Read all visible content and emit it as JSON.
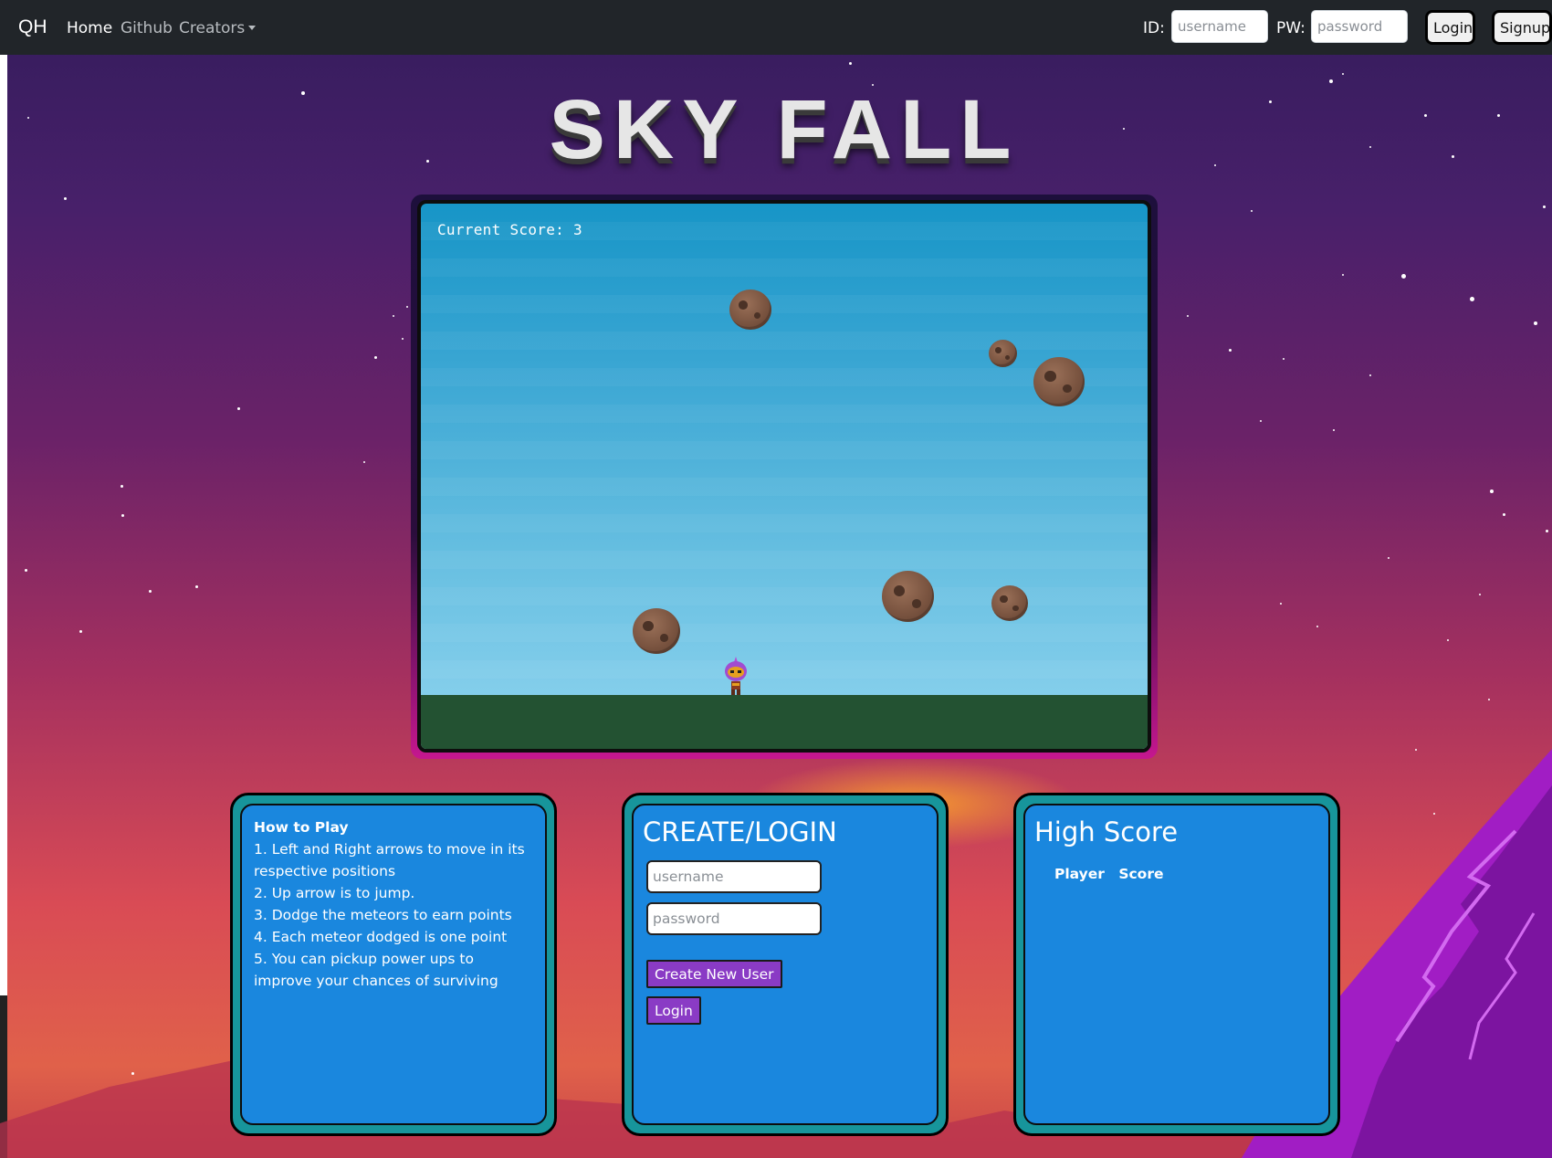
{
  "navbar": {
    "brand": "QH",
    "links": [
      {
        "label": "Home"
      },
      {
        "label": "Github"
      },
      {
        "label": "Creators"
      }
    ],
    "id_label": "ID:",
    "id_placeholder": "username",
    "pw_label": "PW:",
    "pw_placeholder": "password",
    "login_label": "Login",
    "signup_label": "Signup"
  },
  "title": "SKY FALL",
  "game": {
    "score_text": "Current Score: 3",
    "meteor_icon": "meteor-icon",
    "player_icon": "alien-player-icon"
  },
  "howto": {
    "heading": "How to Play",
    "items": [
      "1. Left and Right arrows to move in its respective positions",
      "2. Up arrow is to jump.",
      "3. Dodge the meteors to earn points",
      "4. Each meteor dodged is one point",
      "5. You can pickup power ups to improve your chances of surviving"
    ]
  },
  "create_login": {
    "title": "CREATE/LOGIN",
    "username_placeholder": "username",
    "password_placeholder": "password",
    "create_label": "Create New User",
    "login_label": "Login"
  },
  "high_score": {
    "title": "High Score",
    "columns": [
      "Player",
      "Score"
    ]
  },
  "colors": {
    "navbar": "#212529",
    "panel_outer": "#17959b",
    "panel_inner": "#1a87de",
    "button_purple": "#8a3bc5",
    "ground": "#235232"
  }
}
